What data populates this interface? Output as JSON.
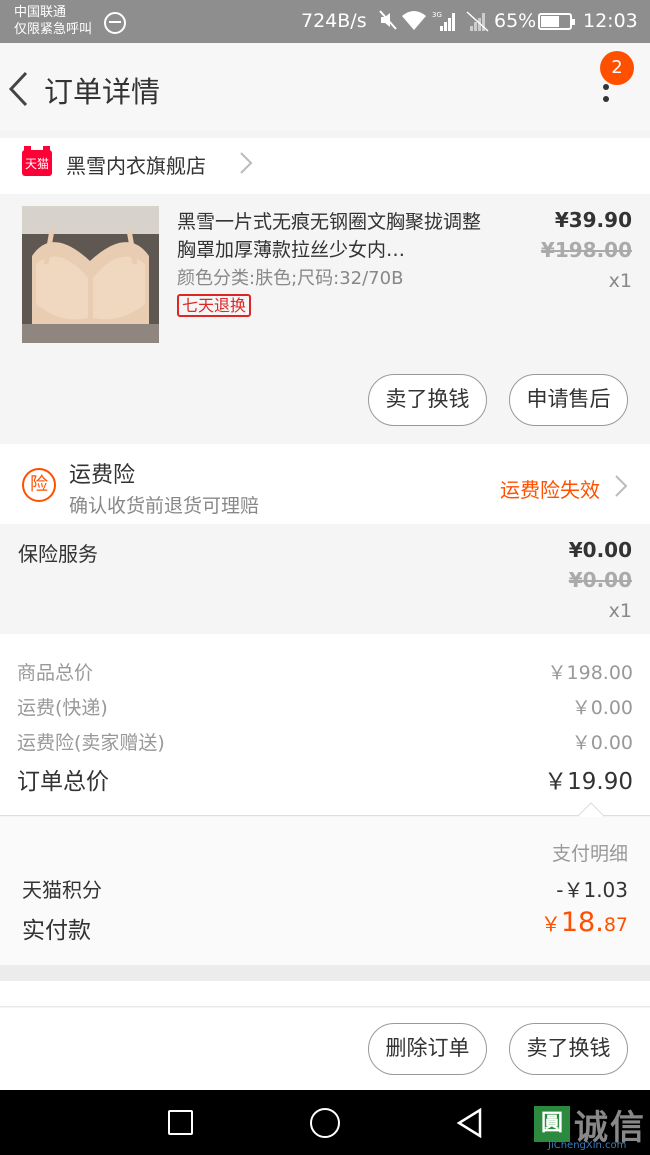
{
  "status_bar": {
    "carrier_line1": "中国联通",
    "carrier_line2": "仅限紧急呼叫",
    "net_speed": "724B/s",
    "network_type": "3G",
    "battery_percent": "65%",
    "battery_level": 0.65,
    "time": "12:03"
  },
  "nav": {
    "title": "订单详情",
    "badge_count": "2"
  },
  "shop": {
    "logo_text": "天猫",
    "name": "黑雪内衣旗舰店"
  },
  "item": {
    "title": "黑雪一片式无痕无钢圈文胸聚拢调整胸罩加厚薄款拉丝少女内…",
    "spec": "颜色分类:肤色;尺码:32/70B",
    "tag": "七天退换",
    "price": "¥39.90",
    "original_price": "¥198.00",
    "quantity": "x1",
    "btn_sell": "卖了换钱",
    "btn_aftersale": "申请售后"
  },
  "insurance": {
    "icon_text": "险",
    "title": "运费险",
    "subtitle": "确认收货前退货可理赔",
    "status": "运费险失效"
  },
  "service": {
    "label": "保险服务",
    "price": "¥0.00",
    "original_price": "¥0.00",
    "quantity": "x1"
  },
  "summary": {
    "rows": [
      {
        "label": "商品总价",
        "value": "￥198.00"
      },
      {
        "label": "运费(快递)",
        "value": "￥0.00"
      },
      {
        "label": "运费险(卖家赠送)",
        "value": "￥0.00"
      }
    ],
    "total_label": "订单总价",
    "total_value": "￥19.90"
  },
  "payment": {
    "detail_link": "支付明细",
    "points_label": "天猫积分",
    "points_value": "-￥1.03",
    "paid_label": "实付款",
    "paid_currency": "￥",
    "paid_int": "18.",
    "paid_dec": "87"
  },
  "footer": {
    "btn_delete": "删除订单",
    "btn_sell": "卖了换钱"
  },
  "watermark": {
    "box": "圓",
    "text": "诚信",
    "url": "JiChengXin.com"
  },
  "colors": {
    "accent": "#ff5000",
    "tmall_red": "#ff0036",
    "tag_red": "#dd2727",
    "status_bar": "#8e8e8e"
  }
}
